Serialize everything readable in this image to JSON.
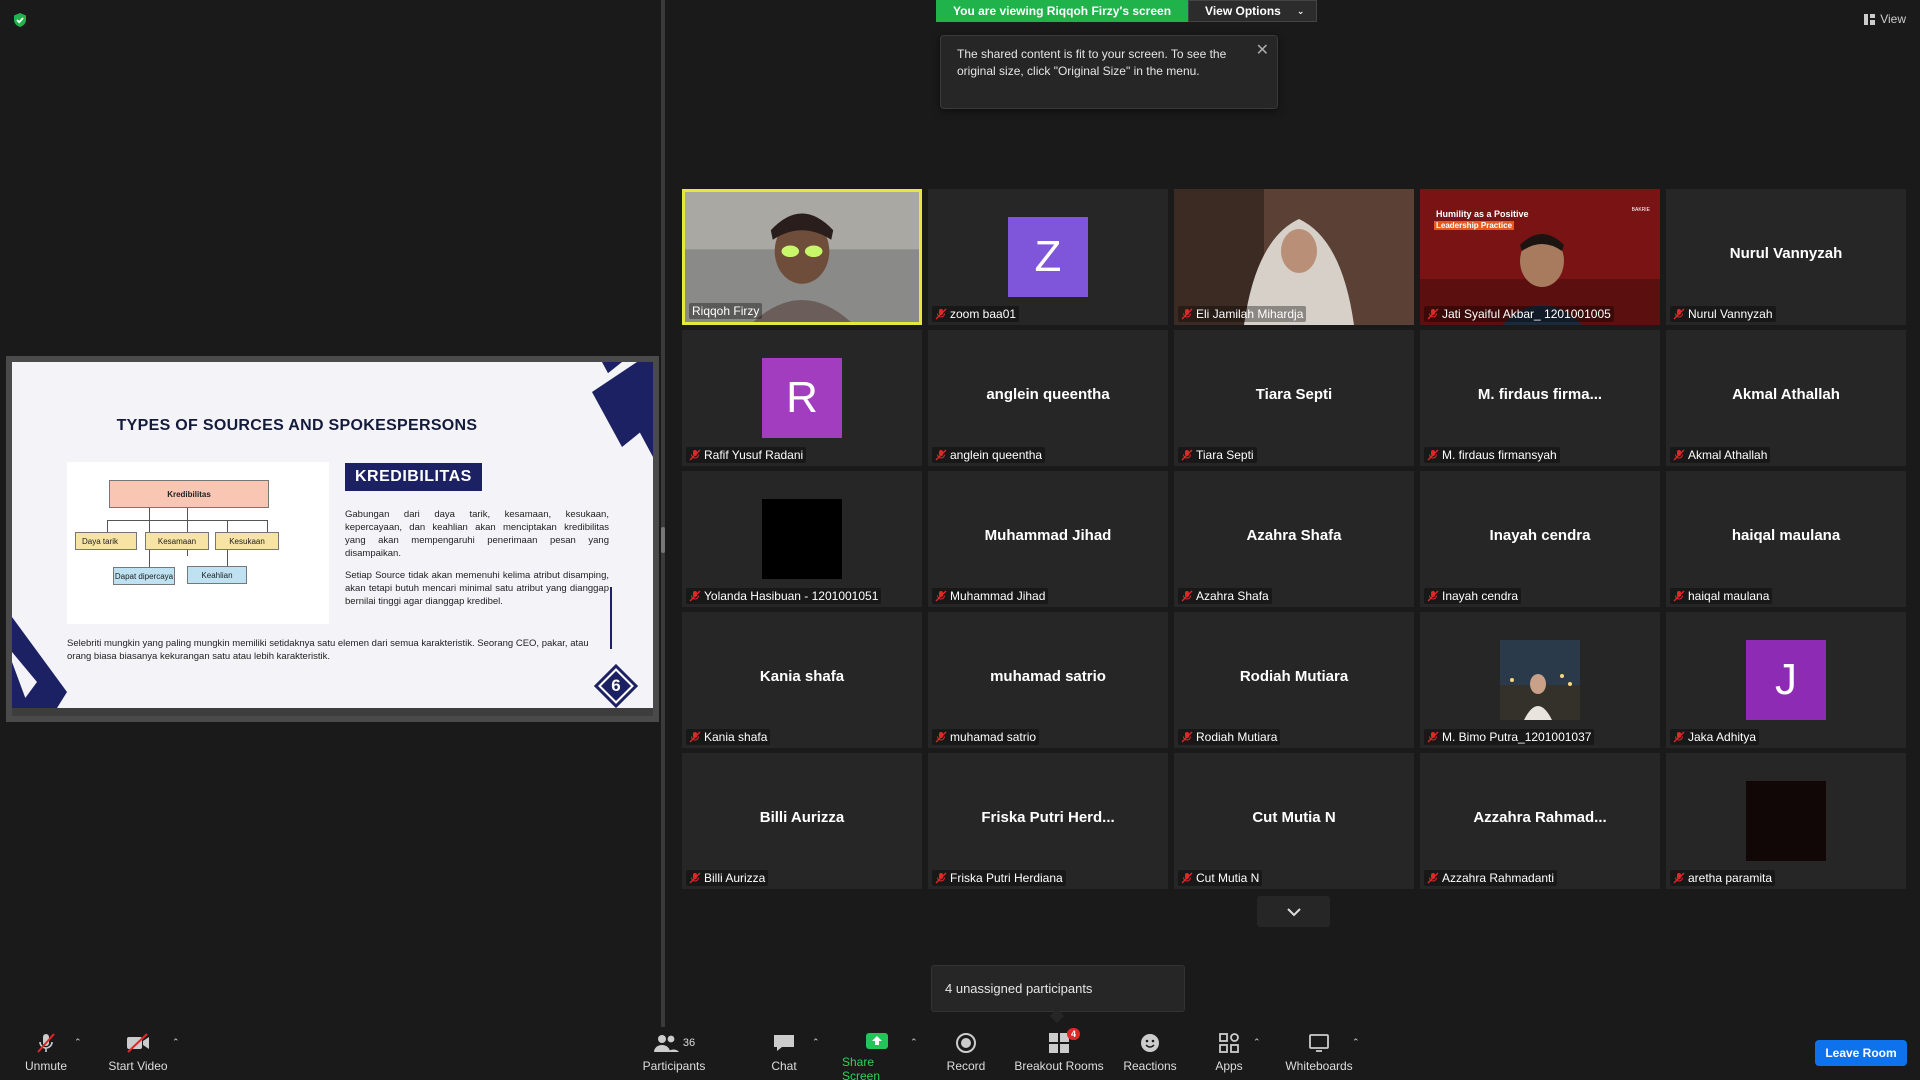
{
  "banner": {
    "viewing_text": "You are viewing Riqqoh Firzy's screen",
    "view_options": "View Options",
    "view_top": "View"
  },
  "tooltip": {
    "text": "The shared content is fit to your screen. To see the original size, click \"Original Size\" in the menu."
  },
  "slide": {
    "title": "TYPES OF SOURCES AND SPOKESPERSONS",
    "badge": "KREDIBILITAS",
    "para1": "Gabungan dari daya tarik, kesamaan, kesukaan, kepercayaan, dan keahlian akan menciptakan kredibilitas yang akan mempengaruhi penerimaan pesan yang disampaikan.",
    "para2": "Setiap Source tidak akan memenuhi kelima atribut disamping, akan tetapi butuh mencari minimal satu atribut yang dianggap bernilai tinggi agar dianggap kredibel.",
    "footer": "Selebriti mungkin yang paling mungkin memiliki setidaknya satu elemen dari semua karakteristik. Seorang CEO, pakar, atau orang biasa biasanya kekurangan satu atau lebih karakteristik.",
    "page_number": "6",
    "diagram": {
      "top": "Kredibilitas",
      "nodes": [
        "Daya tarik",
        "Kesamaan",
        "Kesukaan",
        "Dapat dipercaya",
        "Keahlian"
      ]
    }
  },
  "participants": [
    {
      "name": "Riqqoh Firzy",
      "label": "Riqqoh Firzy",
      "type": "video",
      "muted": false,
      "active": true
    },
    {
      "name": "zoom baa01",
      "label": "zoom baa01",
      "type": "avatar",
      "initial": "Z",
      "color": "#7f56d9",
      "muted": true
    },
    {
      "name": "Eli Jamilah Mihardja",
      "label": "Eli Jamilah Mihardja",
      "type": "video",
      "muted": true
    },
    {
      "name": "Jati Syaiful Akbar_ 1201001005",
      "label": "Jati Syaiful Akbar_ 1201001005",
      "type": "video",
      "muted": true,
      "overlay1": "Humility as a Positive",
      "overlay2": "Leadership Practice",
      "overlay3": "BAKRIE"
    },
    {
      "name": "Nurul Vannyzah",
      "label": "Nurul Vannyzah",
      "type": "name",
      "muted": true
    },
    {
      "name": "Rafif Yusuf Radani",
      "label": "Rafif Yusuf Radani",
      "type": "avatar",
      "initial": "R",
      "color": "#a23dbf",
      "muted": true
    },
    {
      "name": "anglein queentha",
      "label": "anglein queentha",
      "type": "name",
      "muted": true
    },
    {
      "name": "Tiara Septi",
      "label": "Tiara Septi",
      "type": "name",
      "muted": true
    },
    {
      "name": "M. firdaus firma...",
      "label": "M. firdaus firmansyah",
      "type": "name",
      "muted": true
    },
    {
      "name": "Akmal Athallah",
      "label": "Akmal Athallah",
      "type": "name",
      "muted": true
    },
    {
      "name": "Yolanda Hasibuan - 1201001051",
      "label": "Yolanda Hasibuan - 1201001051",
      "type": "avatar",
      "initial": "",
      "color": "#000000",
      "muted": true
    },
    {
      "name": "Muhammad Jihad",
      "label": "Muhammad Jihad",
      "type": "name",
      "muted": true
    },
    {
      "name": "Azahra Shafa",
      "label": "Azahra Shafa",
      "type": "name",
      "muted": true
    },
    {
      "name": "Inayah cendra",
      "label": "Inayah cendra",
      "type": "name",
      "muted": true
    },
    {
      "name": "haiqal maulana",
      "label": "haiqal maulana",
      "type": "name",
      "muted": true
    },
    {
      "name": "Kania shafa",
      "label": "Kania shafa",
      "type": "name",
      "muted": true
    },
    {
      "name": "muhamad satrio",
      "label": "muhamad satrio",
      "type": "name",
      "muted": true
    },
    {
      "name": "Rodiah Mutiara",
      "label": "Rodiah Mutiara",
      "type": "name",
      "muted": true
    },
    {
      "name": "M. Bimo Putra_1201001037",
      "label": "M. Bimo Putra_1201001037",
      "type": "photo",
      "muted": true
    },
    {
      "name": "Jaka Adhitya",
      "label": "Jaka Adhitya",
      "type": "avatar",
      "initial": "J",
      "color": "#8e2bb5",
      "muted": true
    },
    {
      "name": "Billi Aurizza",
      "label": "Billi Aurizza",
      "type": "name",
      "muted": true
    },
    {
      "name": "Friska Putri Herd...",
      "label": "Friska Putri Herdiana",
      "type": "name",
      "muted": true
    },
    {
      "name": "Cut Mutia N",
      "label": "Cut Mutia N",
      "type": "name",
      "muted": true
    },
    {
      "name": "Azzahra Rahmad...",
      "label": "Azzahra Rahmadanti",
      "type": "name",
      "muted": true
    },
    {
      "name": "aretha paramita",
      "label": "aretha paramita",
      "type": "avatar",
      "initial": "",
      "color": "#120707",
      "muted": true
    }
  ],
  "unassigned": "4 unassigned participants",
  "toolbar": {
    "unmute": "Unmute",
    "start_video": "Start Video",
    "participants": "Participants",
    "participants_count": "36",
    "chat": "Chat",
    "share_screen": "Share Screen",
    "record": "Record",
    "breakout_rooms": "Breakout Rooms",
    "breakout_badge": "4",
    "reactions": "Reactions",
    "apps": "Apps",
    "whiteboards": "Whiteboards",
    "leave": "Leave Room"
  }
}
